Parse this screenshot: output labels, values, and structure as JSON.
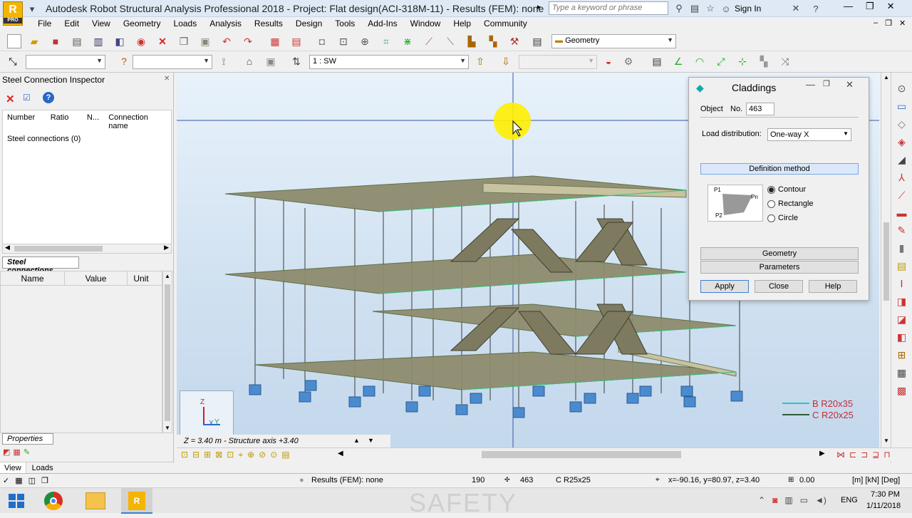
{
  "window": {
    "title": "Autodesk Robot Structural Analysis Professional 2018 - Project: Flat design(ACI-318M-11) - Results (FEM): none",
    "logo_letter": "R",
    "logo_sub": "PRO",
    "search_placeholder": "Type a keyword or phrase",
    "sign_in": "Sign In"
  },
  "menu": [
    "File",
    "Edit",
    "View",
    "Geometry",
    "Loads",
    "Analysis",
    "Results",
    "Design",
    "Tools",
    "Add-Ins",
    "Window",
    "Help",
    "Community"
  ],
  "toolbar": {
    "layout_combo": "Geometry",
    "view_combo": "1 : SW"
  },
  "inspector": {
    "title": "Steel Connection Inspector",
    "columns": [
      "Number",
      "Ratio",
      "N...",
      "Connection name"
    ],
    "tree_item": "Steel connections (0)",
    "tab": "Steel connections",
    "prop_columns": [
      "Name",
      "Value",
      "Unit"
    ],
    "properties_tab": "Properties",
    "bottom_tabs": [
      "View",
      "Loads"
    ]
  },
  "dialog": {
    "title": "Claddings",
    "object_label": "Object",
    "no_label": "No.",
    "no_value": "463",
    "load_dist_label": "Load distribution:",
    "load_dist_value": "One-way X",
    "definition_method": "Definition method",
    "options": [
      "Contour",
      "Rectangle",
      "Circle"
    ],
    "selected_option": "Contour",
    "geometry_btn": "Geometry",
    "parameters_btn": "Parameters",
    "apply": "Apply",
    "close": "Close",
    "help": "Help",
    "preview_p1": "P1",
    "preview_p2": "P2",
    "preview_pn": "Pn"
  },
  "legend": [
    {
      "label": "B R20x35",
      "color": "#27c9b5"
    },
    {
      "label": "C R20x25",
      "color": "#2f5a3a"
    }
  ],
  "axis_labels": {
    "z": "Z",
    "x": "X",
    "y": "Y"
  },
  "viewport_status": "Z = 3.40 m - Structure axis +3.40",
  "statusbar": {
    "results": "Results (FEM): none",
    "count": "190",
    "node": "463",
    "section": "C R25x25",
    "coords": "x=-90.16, y=80.97, z=3.40",
    "value": "0.00",
    "units": "[m] [kN] [Deg]"
  },
  "taskbar": {
    "lang": "ENG",
    "time": "7:30 PM",
    "date": "1/11/2018",
    "watermark": "SAFETY"
  },
  "colors": {
    "accent": "#f4b400",
    "slab": "#8f8c6e",
    "column": "#4a8bd0"
  }
}
